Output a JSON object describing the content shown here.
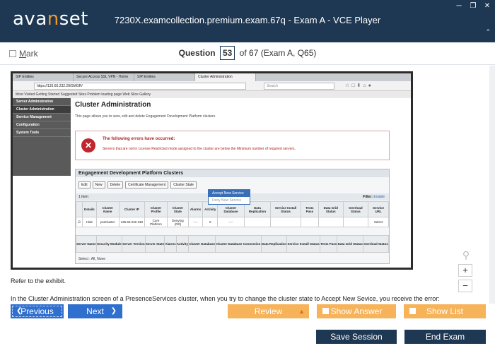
{
  "header": {
    "logo_pre": "ava",
    "logo_accent": "n",
    "logo_post": "set",
    "title": "7230X.examcollection.premium.exam.67q - Exam A - VCE Player",
    "controls": [
      "minimize-icon",
      "restore-icon",
      "close-icon"
    ],
    "colors": {
      "bg": "#1e3853",
      "accent": "#f39a24"
    }
  },
  "question_bar": {
    "mark_label_first": "M",
    "mark_label_rest": "ark",
    "question_prefix": "Question",
    "current": "53",
    "of_text": "of 67 (Exam A, Q65)"
  },
  "exhibit": {
    "tabs": [
      "SIP Entities",
      "Secure Access SSL VPN - Home",
      "SIP Entities",
      "Cluster Administration"
    ],
    "url": "https://135.60.232.28/SMGR/",
    "search_placeholder": "Search",
    "bookmarks": "Most Visited   Getting Started   Suggested Sites   Problem loading page   Web Slice Gallery",
    "sidenav": [
      "Server Administration",
      "Cluster Administration",
      "Service Management",
      "Configuration",
      "System Tools"
    ],
    "page_title": "Cluster Administration",
    "page_desc": "This page allows you to view, edit and delete Engagement Development Platform clusters.",
    "error_title": "The following errors have occurred:",
    "error_msg": "Servers that are not in License Restricted mode assigned to the cluster are below the Minimum number of required servers.",
    "panel_title": "Engagement Development Platform Clusters",
    "toolbar": [
      "Edit",
      "New",
      "Delete",
      "Certificate Management",
      "Cluster State"
    ],
    "dropdown": [
      "Accept New Service",
      "Deny New Service"
    ],
    "items": "1 Item",
    "filter_label": "Filter:",
    "filter_value": "Enable",
    "grid1_headers": [
      "",
      "Details",
      "Cluster Name",
      "Cluster IP",
      "Cluster Profile",
      "Cluster State",
      "Alarms",
      "Activity",
      "Cluster Database",
      "Data Replication",
      "Service Install Status",
      "Tests Pass",
      "Data Grid Status",
      "Overload Status",
      "Service URL"
    ],
    "grid1_row": [
      "",
      "Hide",
      "ps3cluster",
      "135.60.232.138",
      "Core Platform",
      "Denying [0/0]",
      "----",
      "0",
      "----",
      "",
      "",
      "",
      "",
      "",
      "Select"
    ],
    "grid2_headers": [
      "Server Name",
      "Security Module",
      "Server Version",
      "Server State",
      "Alarms",
      "Activity",
      "Cluster Database",
      "Cluster Database Connection",
      "Data Replication",
      "Service Install Status",
      "Tests Pass",
      "Data Grid Status",
      "Overload Status"
    ],
    "select_info": "Select : All, None"
  },
  "content": {
    "para1": "Refer to the exhibit.",
    "para2": "In the Cluster Administration screen of a PresenceServices cluster, when you try to change the cluster state to Accept New Sevice, you receive the error:"
  },
  "zoom": {
    "magnifier": "magnifier-icon",
    "in": "+",
    "out": "−"
  },
  "footer": {
    "previous": "Previous",
    "next": "Next",
    "review": "Review",
    "show_answer": "Show Answer",
    "show_list": "Show List",
    "save_session": "Save Session",
    "end_exam": "End Exam",
    "colors": {
      "nav": "#2f6fce",
      "orange": "#f6b35a",
      "dark": "#1e3853"
    }
  }
}
